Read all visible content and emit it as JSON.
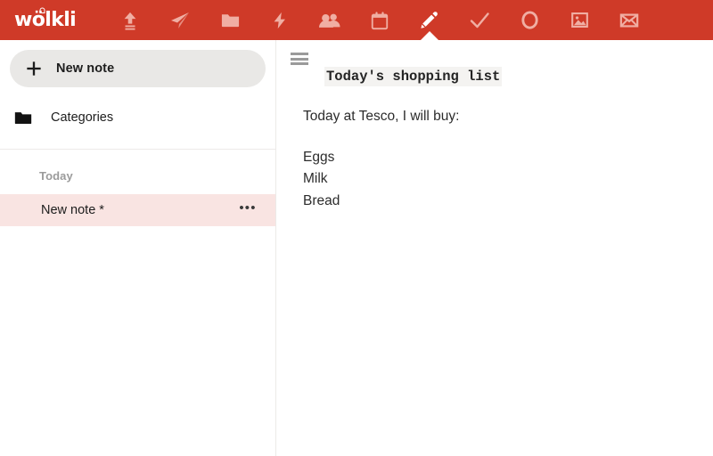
{
  "app": {
    "brand": "wölkli",
    "brand_mark_icon": "cloud-mark-icon",
    "accent_color": "#cf3a28",
    "selected_row_color": "#f9e4e2",
    "button_color": "#e9e8e6"
  },
  "toolbar": {
    "items": [
      {
        "name": "upload-icon",
        "label": "Upload",
        "active": false
      },
      {
        "name": "send-icon",
        "label": "Send",
        "active": false
      },
      {
        "name": "folder-icon",
        "label": "Files",
        "active": false
      },
      {
        "name": "activity-icon",
        "label": "Activity",
        "active": false
      },
      {
        "name": "contacts-icon",
        "label": "Contacts",
        "active": false
      },
      {
        "name": "calendar-icon",
        "label": "Calendar",
        "active": false
      },
      {
        "name": "notes-icon",
        "label": "Notes",
        "active": true
      },
      {
        "name": "tasks-icon",
        "label": "Tasks",
        "active": false
      },
      {
        "name": "circle-icon",
        "label": "Circles",
        "active": false
      },
      {
        "name": "photos-icon",
        "label": "Photos",
        "active": false
      },
      {
        "name": "mail-icon",
        "label": "Mail",
        "active": false
      }
    ]
  },
  "sidebar": {
    "new_note_label": "New note",
    "new_note_icon": "plus-icon",
    "categories_label": "Categories",
    "categories_icon": "folder-icon",
    "groups": [
      {
        "label": "Today",
        "notes": [
          {
            "title": "New note *",
            "selected": true,
            "menu_label": "•••"
          }
        ]
      }
    ]
  },
  "main": {
    "menu_icon": "hamburger-menu-icon",
    "note": {
      "title": "Today's shopping list",
      "paragraph": "Today at Tesco, I will buy:",
      "items": [
        "Eggs",
        "Milk",
        "Bread"
      ]
    }
  }
}
